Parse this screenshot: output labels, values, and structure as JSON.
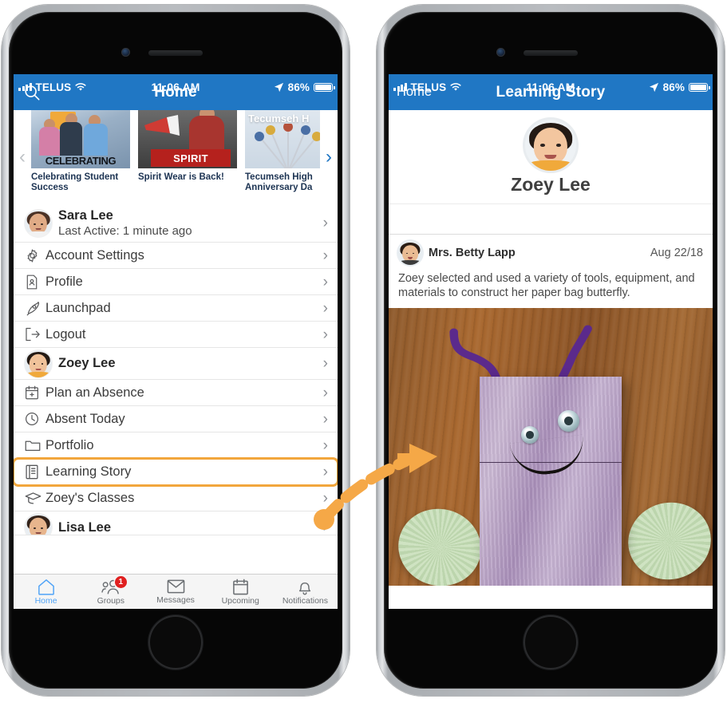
{
  "colors": {
    "nav_blue": "#2077C4",
    "highlight_orange": "#F2A63C",
    "arrow_orange": "#F5A847",
    "badge_red": "#E02020",
    "tab_active": "#4FA3F7"
  },
  "status_bar": {
    "carrier": "TELUS",
    "wifi_icon": "wifi-icon",
    "signal_icon": "cellular-signal-icon",
    "time": "11:06 AM",
    "location_icon": "location-arrow-icon",
    "battery_percent": "86%",
    "battery_icon": "battery-full-icon"
  },
  "left_phone": {
    "nav": {
      "search_icon": "search-icon",
      "title": "Home"
    },
    "carousel": {
      "prev_icon": "chevron-left-icon",
      "next_icon": "chevron-right-icon",
      "cards": [
        {
          "caption": "Celebrating Student Success",
          "overlay_text": "CELEBRATING"
        },
        {
          "caption": "Spirit Wear is Back!",
          "overlay_text": "SPIRIT"
        },
        {
          "caption": "Tecumseh High Anniversary Da",
          "overlay_text": "Tecumseh H"
        }
      ]
    },
    "list": [
      {
        "type": "user",
        "name": "Sara Lee",
        "sub": "Last Active: 1 minute ago",
        "icon": "avatar-sara-lee",
        "chevron": "›"
      },
      {
        "type": "item",
        "label": "Account Settings",
        "icon": "gear-icon",
        "chevron": "›"
      },
      {
        "type": "item",
        "label": "Profile",
        "icon": "profile-card-icon",
        "chevron": "›"
      },
      {
        "type": "item",
        "label": "Launchpad",
        "icon": "rocket-icon",
        "chevron": "›"
      },
      {
        "type": "item",
        "label": "Logout",
        "icon": "logout-icon",
        "chevron": "›"
      },
      {
        "type": "user",
        "name": "Zoey Lee",
        "sub": "",
        "icon": "avatar-zoey-lee",
        "chevron": "›"
      },
      {
        "type": "item",
        "label": "Plan an Absence",
        "icon": "calendar-plus-icon",
        "chevron": "›"
      },
      {
        "type": "item",
        "label": "Absent Today",
        "icon": "clock-icon",
        "chevron": "›"
      },
      {
        "type": "item",
        "label": "Portfolio",
        "icon": "folder-icon",
        "chevron": "›"
      },
      {
        "type": "item",
        "label": "Learning Story",
        "icon": "book-icon",
        "chevron": "›",
        "highlighted": true
      },
      {
        "type": "item",
        "label": "Zoey's Classes",
        "icon": "graduation-cap-icon",
        "chevron": "›"
      },
      {
        "type": "user",
        "name": "Lisa Lee",
        "sub": "",
        "icon": "avatar-lisa-lee",
        "chevron": "›"
      }
    ],
    "tabs": [
      {
        "label": "Home",
        "icon": "home-icon",
        "active": true,
        "badge": ""
      },
      {
        "label": "Groups",
        "icon": "groups-icon",
        "active": false,
        "badge": "1"
      },
      {
        "label": "Messages",
        "icon": "envelope-icon",
        "active": false,
        "badge": ""
      },
      {
        "label": "Upcoming",
        "icon": "calendar-icon",
        "active": false,
        "badge": ""
      },
      {
        "label": "Notifications",
        "icon": "bell-icon",
        "active": false,
        "badge": ""
      }
    ]
  },
  "right_phone": {
    "nav": {
      "back_label": "Home",
      "title": "Learning Story"
    },
    "student": {
      "name": "Zoey Lee",
      "avatar": "avatar-zoey-lee"
    },
    "post": {
      "author": "Mrs. Betty Lapp",
      "author_avatar": "avatar-betty-lapp",
      "date": "Aug 22/18",
      "text": "Zoey selected and used a variety of tools, equipment, and materials to construct her paper bag butterfly.",
      "photo_alt": "paper-bag-butterfly-craft-photo"
    }
  },
  "annotation": {
    "arrow_icon": "dashed-curved-arrow",
    "from": "learning-story-row",
    "to": "learning-story-screen"
  }
}
